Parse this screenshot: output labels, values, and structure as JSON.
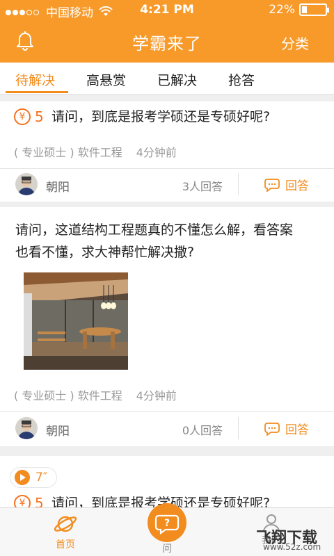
{
  "status_bar": {
    "carrier": "中国移动",
    "time": "4:21 PM",
    "battery": "22%",
    "battery_level": 0.22
  },
  "header": {
    "title": "学霸来了",
    "category": "分类"
  },
  "tabs": [
    {
      "label": "待解决",
      "active": true
    },
    {
      "label": "高悬赏",
      "active": false
    },
    {
      "label": "已解决",
      "active": false
    },
    {
      "label": "抢答",
      "active": false
    }
  ],
  "questions": [
    {
      "reward": "5",
      "text": "请问，到底是报考学硕还是专硕好呢?",
      "tag": "( 专业硕士 ) 软件工程",
      "time": "4分钟前",
      "user": "朝阳",
      "answers": "3人回答",
      "answer_label": "回答"
    },
    {
      "text_line1": "请问，这道结构工程题真的不懂怎么解，看答案",
      "text_line2": "也看不懂，求大神帮忙解决撒?",
      "tag": "( 专业硕士 ) 软件工程",
      "time": "4分钟前",
      "user": "朝阳",
      "answers": "0人回答",
      "answer_label": "回答"
    },
    {
      "voice": "7″",
      "reward": "5",
      "text": "请问，到底是报考学硕还是专硕好呢?"
    }
  ],
  "tabbar": {
    "home": "首页",
    "ask": "问",
    "mine": "我的"
  },
  "watermark": {
    "main": "飞翔下载",
    "sub": "www.52z.com"
  },
  "colors": {
    "brand": "#f79a2a",
    "accent": "#f28c1e",
    "reward": "#f5711e"
  }
}
